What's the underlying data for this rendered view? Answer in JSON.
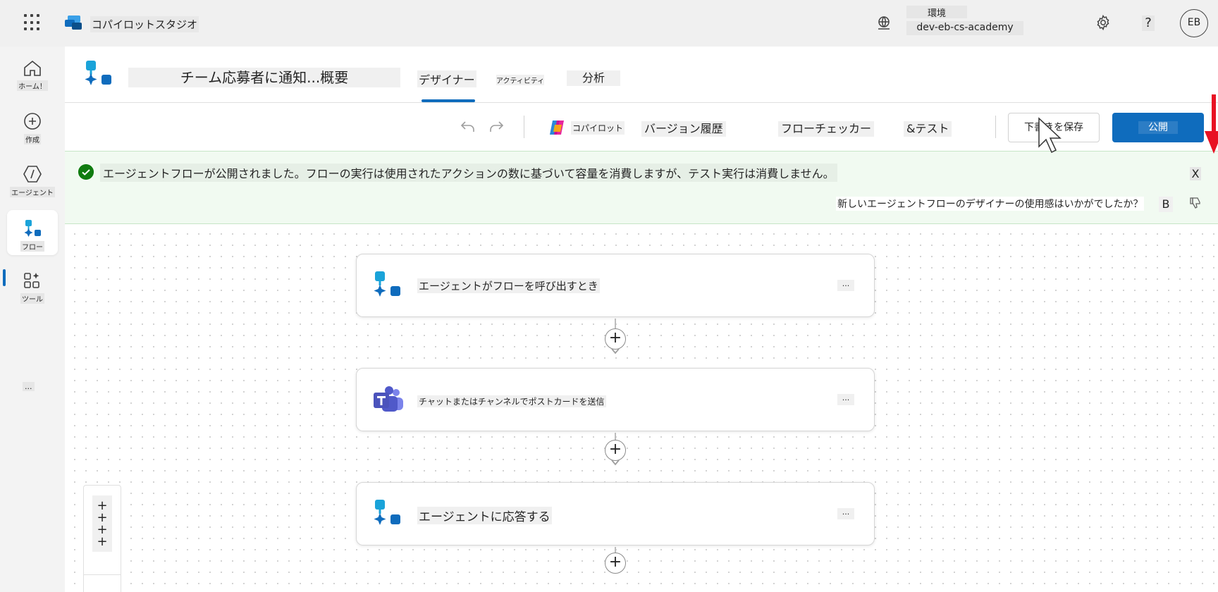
{
  "topbar": {
    "app_name": "コパイロットスタジオ",
    "environment_label": "環境",
    "environment_value": "dev-eb-cs-academy",
    "help_label": "?",
    "avatar_initials": "EB"
  },
  "rail": {
    "items": [
      {
        "label": "ホーム！",
        "icon": "home-icon"
      },
      {
        "label": "作成",
        "icon": "plus-circle-icon"
      },
      {
        "label": "エージェント",
        "icon": "agent-icon"
      },
      {
        "label": "フロー",
        "icon": "flow-icon",
        "active": true
      },
      {
        "label": "ツール",
        "icon": "tools-icon"
      }
    ],
    "more_label": "..."
  },
  "header": {
    "flow_title": "チーム応募者に通知...概要",
    "tabs": [
      {
        "label": "デザイナー",
        "active": true
      },
      {
        "label": "アクティビティ"
      },
      {
        "label": "分析"
      }
    ]
  },
  "toolbar": {
    "copilot_label": "コパイロット",
    "version_history_label": "バージョン履歴",
    "flow_checker_label": "フローチェッカー",
    "test_label": "&テスト",
    "save_draft_label": "下書きを保存",
    "publish_label": "公開"
  },
  "banner": {
    "message": "エージェントフローが公開されました。フローの実行は使用されたアクションの数に基づいて容量を消費しますが、テスト実行は消費しません。",
    "close_label": "X",
    "feedback_question": "新しいエージェントフローのデザイナーの使用感はいかがでしたか？",
    "feedback_b": "B"
  },
  "canvas": {
    "nodes": [
      {
        "label": "エージェントがフローを呼び出すとき",
        "icon": "agent-flow-icon",
        "more": "..."
      },
      {
        "label": "チャットまたはチャンネルでポストカードを送信",
        "icon": "teams-icon",
        "more": "..."
      },
      {
        "label": "エージェントに応答する",
        "icon": "agent-flow-icon",
        "more": "..."
      }
    ],
    "add_label": "+",
    "zoom_controls": "+\n+\n+\n+"
  },
  "colors": {
    "accent": "#0f6cbd",
    "success": "#107c10",
    "annotation_arrow": "#e81123"
  }
}
